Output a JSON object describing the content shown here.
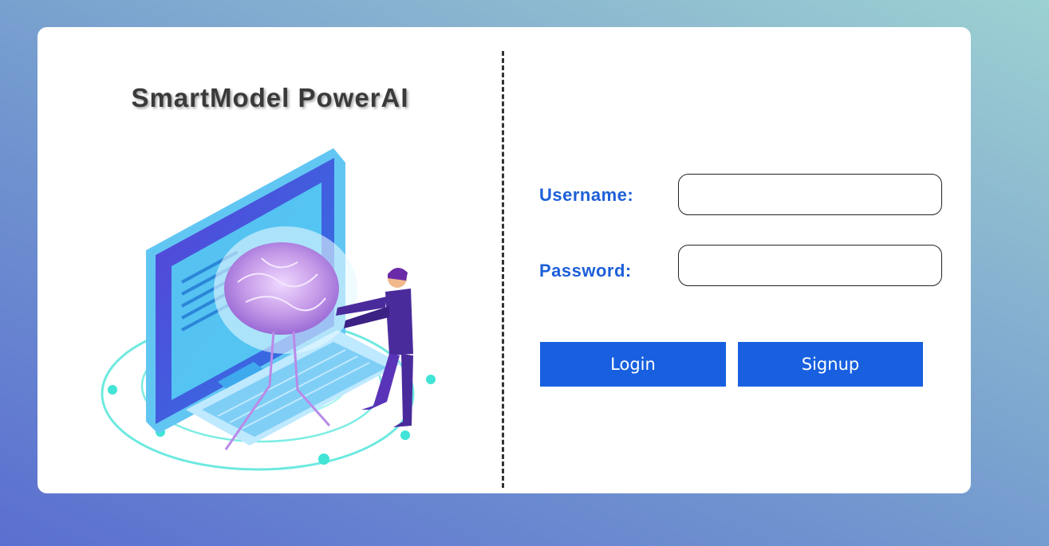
{
  "brand": {
    "title": "SmartModel PowerAI"
  },
  "illustration": {
    "icon": "ai-brain-computer-illustration"
  },
  "form": {
    "username_label": "Username:",
    "username_value": "",
    "password_label": "Password:",
    "password_value": "",
    "login_label": "Login",
    "signup_label": "Signup"
  },
  "colors": {
    "accent": "#1860e0",
    "label": "#1d5fd8",
    "title": "#3a3a3a"
  }
}
